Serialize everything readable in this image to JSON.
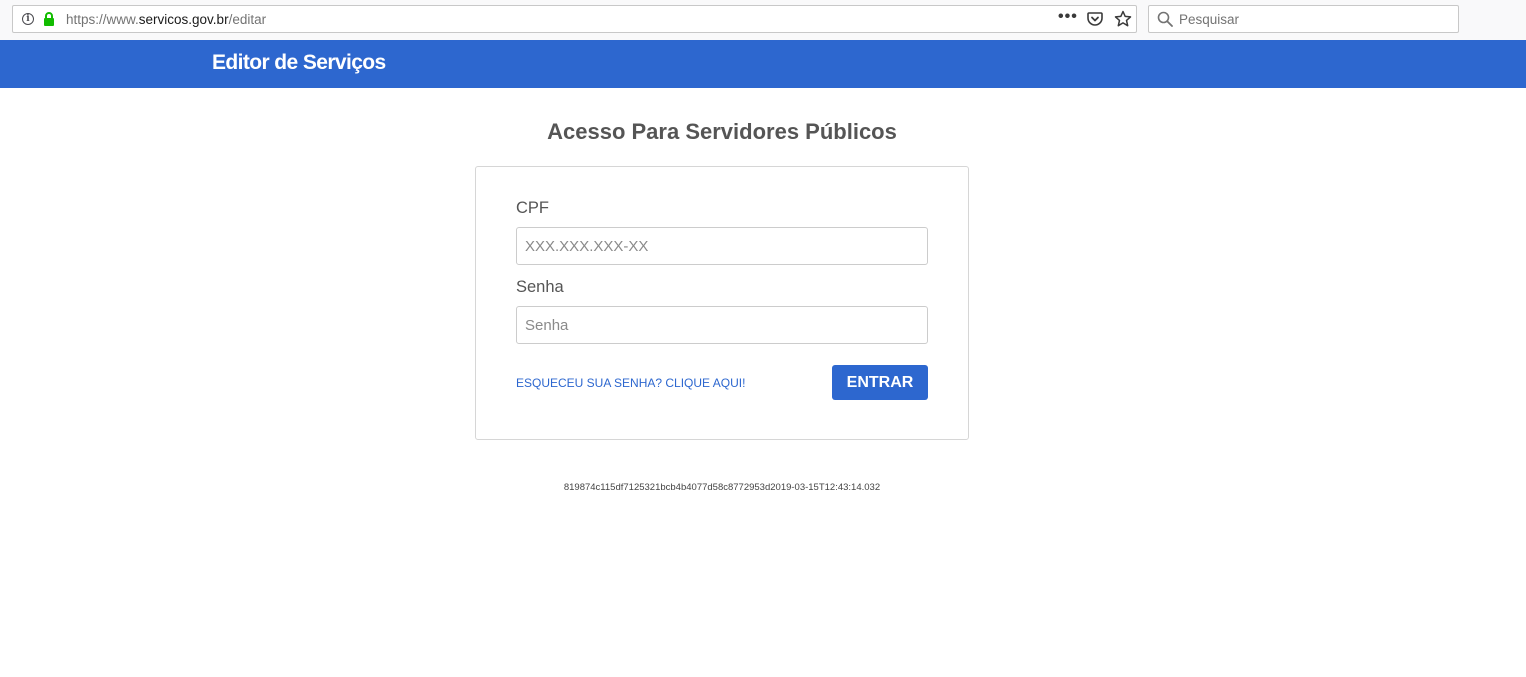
{
  "browser": {
    "url_prefix": "https://www.",
    "url_host": "servicos.gov.br",
    "url_path": "/editar",
    "more_icon": "ellipsis-icon",
    "search_placeholder": "Pesquisar"
  },
  "header": {
    "title": "Editor de Serviços",
    "background_color": "#2d67cf"
  },
  "login": {
    "title": "Acesso Para Servidores Públicos",
    "cpf_label": "CPF",
    "cpf_placeholder": "XXX.XXX.XXX-XX",
    "cpf_value": "",
    "password_label": "Senha",
    "password_placeholder": "Senha",
    "password_value": "",
    "forgot_link": "ESQUECEU SUA SENHA? CLIQUE AQUI!",
    "submit_label": "ENTRAR",
    "accent_color": "#2d67cf"
  },
  "footer": {
    "build_info": "819874c115df7125321bcb4b4077d58c8772953d2019-03-15T12:43:14.032"
  }
}
